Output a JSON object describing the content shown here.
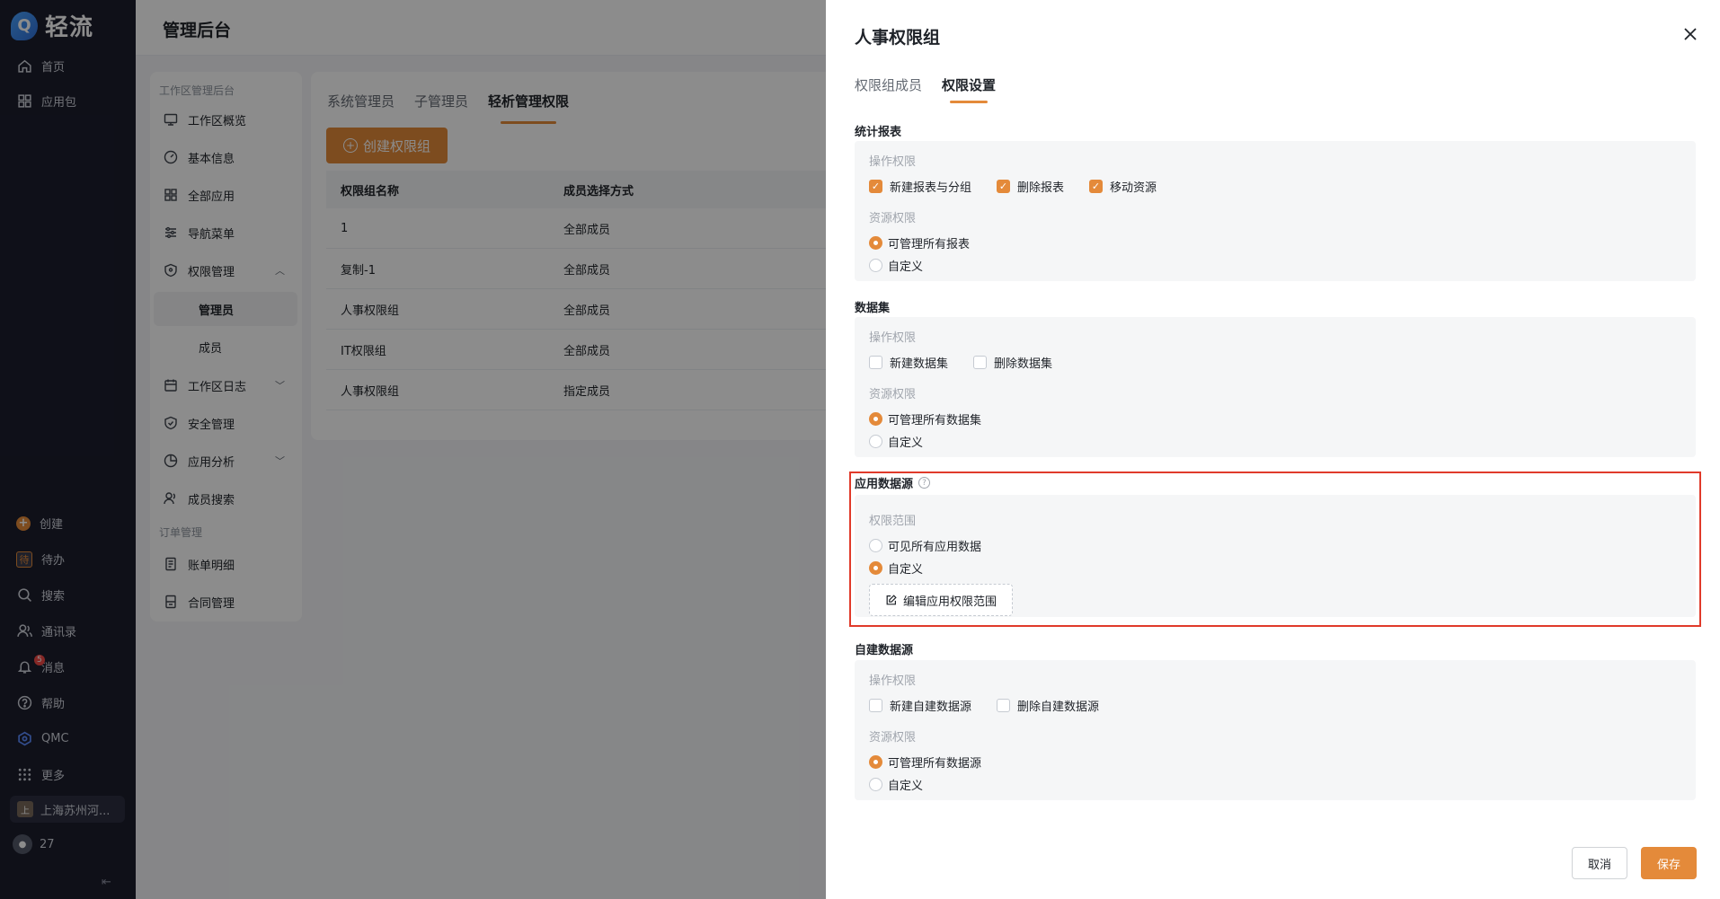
{
  "app": {
    "brand": "轻流",
    "brand_logo_letter": "Q"
  },
  "leftnav": {
    "top_items": [
      {
        "label": "首页",
        "icon": "home-icon"
      },
      {
        "label": "应用包",
        "icon": "grid-icon"
      }
    ],
    "bottom_items": [
      {
        "label": "创建",
        "icon": "plus-circle-icon"
      },
      {
        "label": "待办",
        "icon": "todo-icon",
        "glyph": "待"
      },
      {
        "label": "搜索",
        "icon": "search-icon"
      },
      {
        "label": "通讯录",
        "icon": "contacts-icon"
      },
      {
        "label": "消息",
        "icon": "bell-icon",
        "badge": "5"
      },
      {
        "label": "帮助",
        "icon": "help-icon"
      },
      {
        "label": "QMC",
        "icon": "qmc-icon"
      },
      {
        "label": "更多",
        "icon": "apps-icon"
      }
    ],
    "org": {
      "name": "上海苏州河...",
      "avatar": "上"
    },
    "user": {
      "name": "27"
    },
    "collapse_icon": "collapse-icon"
  },
  "main": {
    "title": "管理后台",
    "subnav": {
      "group1": "工作区管理后台",
      "items": [
        {
          "label": "工作区概览",
          "icon": "monitor-icon"
        },
        {
          "label": "基本信息",
          "icon": "dashboard-icon"
        },
        {
          "label": "全部应用",
          "icon": "grid-icon"
        },
        {
          "label": "导航菜单",
          "icon": "sliders-icon"
        },
        {
          "label": "权限管理",
          "icon": "shield-key-icon",
          "caret": "︿"
        }
      ],
      "sub_items": [
        {
          "label": "管理员"
        },
        {
          "label": "成员"
        }
      ],
      "items2": [
        {
          "label": "工作区日志",
          "icon": "calendar-icon",
          "caret": "﹀"
        },
        {
          "label": "安全管理",
          "icon": "shield-check-icon"
        },
        {
          "label": "应用分析",
          "icon": "pie-icon",
          "caret": "﹀"
        },
        {
          "label": "成员搜索",
          "icon": "users-icon"
        }
      ],
      "group2": "订单管理",
      "items3": [
        {
          "label": "账单明细",
          "icon": "bill-icon"
        },
        {
          "label": "合同管理",
          "icon": "contract-icon"
        }
      ]
    },
    "tabs": [
      "系统管理员",
      "子管理员",
      "轻析管理权限"
    ],
    "create_button": "创建权限组",
    "table": {
      "headers": [
        "权限组名称",
        "成员选择方式"
      ],
      "rows": [
        [
          "1",
          "全部成员"
        ],
        [
          "复制-1",
          "全部成员"
        ],
        [
          "人事权限组",
          "全部成员"
        ],
        [
          "IT权限组",
          "全部成员"
        ],
        [
          "人事权限组",
          "指定成员"
        ]
      ]
    }
  },
  "drawer": {
    "title": "人事权限组",
    "tabs": [
      "权限组成员",
      "权限设置"
    ],
    "sections": {
      "reports": {
        "title": "统计报表",
        "op_label": "操作权限",
        "op_checks": [
          {
            "label": "新建报表与分组",
            "checked": true
          },
          {
            "label": "删除报表",
            "checked": true
          },
          {
            "label": "移动资源",
            "checked": true
          }
        ],
        "res_label": "资源权限",
        "res_options": [
          {
            "label": "可管理所有报表",
            "selected": true
          },
          {
            "label": "自定义",
            "selected": false
          }
        ]
      },
      "datasets": {
        "title": "数据集",
        "op_label": "操作权限",
        "op_checks": [
          {
            "label": "新建数据集",
            "checked": false
          },
          {
            "label": "删除数据集",
            "checked": false
          }
        ],
        "res_label": "资源权限",
        "res_options": [
          {
            "label": "可管理所有数据集",
            "selected": true
          },
          {
            "label": "自定义",
            "selected": false
          }
        ]
      },
      "app_source": {
        "title": "应用数据源",
        "help_icon": "question-circle-icon",
        "scope_label": "权限范围",
        "scope_options": [
          {
            "label": "可见所有应用数据",
            "selected": false
          },
          {
            "label": "自定义",
            "selected": true
          }
        ],
        "edit_button": "编辑应用权限范围"
      },
      "custom_source": {
        "title": "自建数据源",
        "op_label": "操作权限",
        "op_checks": [
          {
            "label": "新建自建数据源",
            "checked": false
          },
          {
            "label": "删除自建数据源",
            "checked": false
          }
        ],
        "res_label": "资源权限",
        "res_options": [
          {
            "label": "可管理所有数据源",
            "selected": true
          },
          {
            "label": "自定义",
            "selected": false
          }
        ]
      }
    },
    "cancel_button": "取消",
    "save_button": "保存"
  },
  "colors": {
    "accent": "#e48a3a",
    "highlight_border": "#e03a2a",
    "sidebar_bg": "#1c1e2d"
  }
}
